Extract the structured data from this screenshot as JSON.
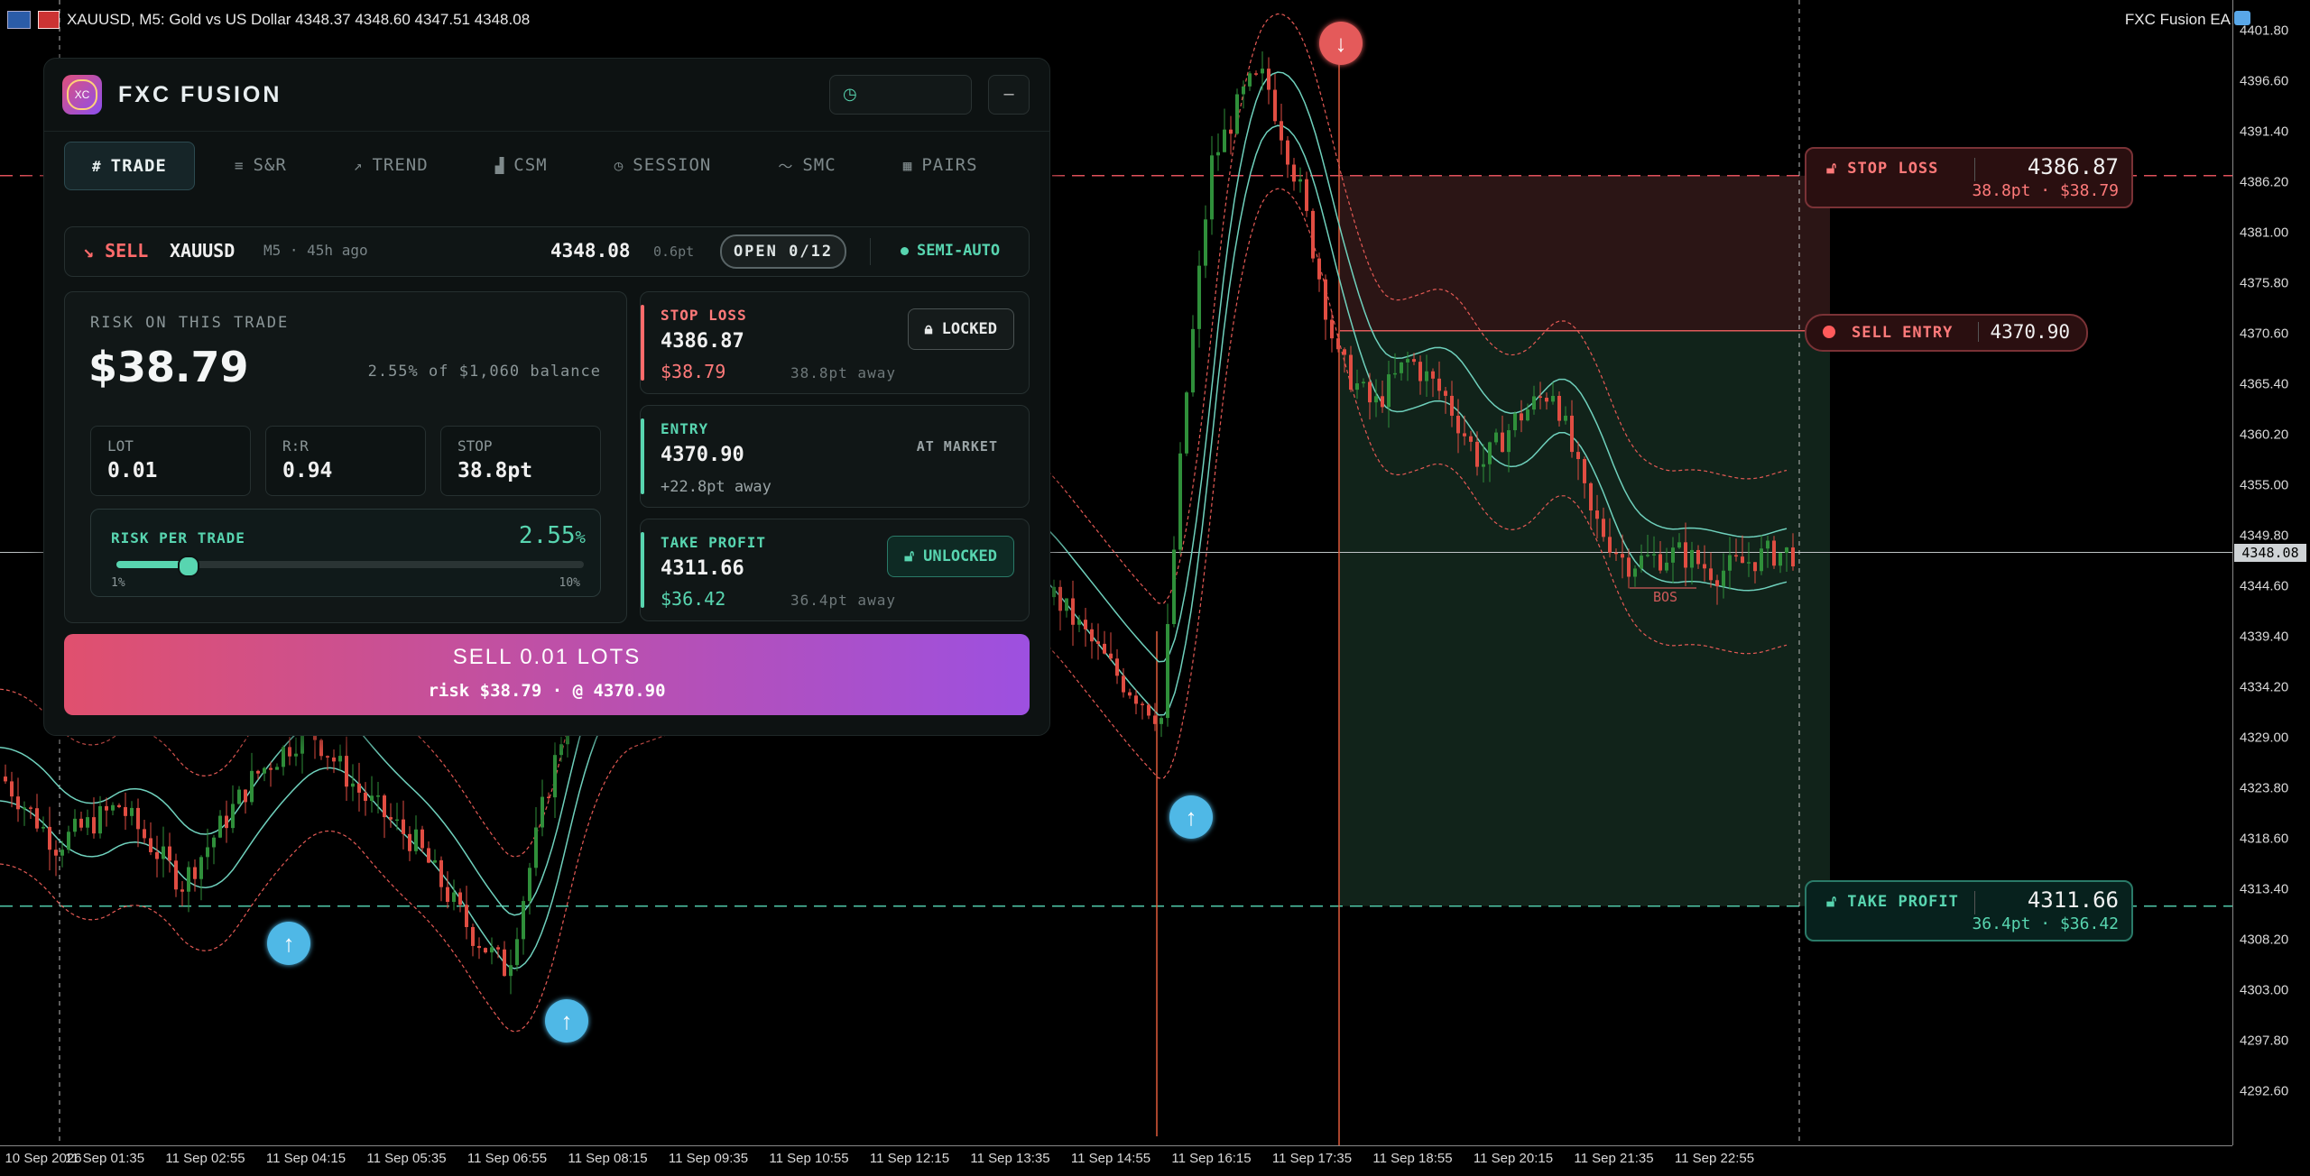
{
  "chart_header": {
    "title": "XAUUSD, M5:  Gold vs US Dollar   4348.37 4348.60 4347.51 4348.08",
    "ea_name": "FXC Fusion EA"
  },
  "colors": {
    "bull": "#2f8f3a",
    "bear": "#e04d42",
    "sl": "#ff6b6b",
    "tp": "#58d5b0",
    "band_inner": "#6fd1bd",
    "band_outer": "#e55a55"
  },
  "y_axis": {
    "ticks": [
      "4401.80",
      "4396.60",
      "4391.40",
      "4386.20",
      "4381.00",
      "4375.80",
      "4370.60",
      "4365.40",
      "4360.20",
      "4355.00",
      "4349.80",
      "4344.60",
      "4339.40",
      "4334.20",
      "4329.00",
      "4323.80",
      "4318.60",
      "4313.40",
      "4308.20",
      "4303.00",
      "4297.80",
      "4292.60"
    ],
    "current_price": "4348.08"
  },
  "x_axis": {
    "ticks": [
      "10 Sep 2026",
      "11 Sep 01:35",
      "11 Sep 02:55",
      "11 Sep 04:15",
      "11 Sep 05:35",
      "11 Sep 06:55",
      "11 Sep 08:15",
      "11 Sep 09:35",
      "11 Sep 10:55",
      "11 Sep 12:15",
      "11 Sep 13:35",
      "11 Sep 14:55",
      "11 Sep 16:15",
      "11 Sep 17:35",
      "11 Sep 18:55",
      "11 Sep 20:15",
      "11 Sep 21:35",
      "11 Sep 22:55"
    ]
  },
  "chart_data": {
    "type": "candlestick",
    "ylim": [
      4288.0,
      4404.0
    ],
    "levels": {
      "stop_loss": 4386.87,
      "entry": 4370.9,
      "take_profit": 4311.66,
      "current": 4348.08
    },
    "segments": [
      {
        "x": 0,
        "p": 4325
      },
      {
        "x": 60,
        "p": 4318
      },
      {
        "x": 130,
        "p": 4322
      },
      {
        "x": 200,
        "p": 4314
      },
      {
        "x": 280,
        "p": 4325
      },
      {
        "x": 340,
        "p": 4330
      },
      {
        "x": 400,
        "p": 4323
      },
      {
        "x": 460,
        "p": 4318
      },
      {
        "x": 520,
        "p": 4309
      },
      {
        "x": 560,
        "p": 4305
      },
      {
        "x": 600,
        "p": 4322
      },
      {
        "x": 640,
        "p": 4336
      },
      {
        "x": 700,
        "p": 4338
      },
      {
        "x": 760,
        "p": 4340
      },
      {
        "x": 820,
        "p": 4345
      },
      {
        "x": 880,
        "p": 4350
      },
      {
        "x": 940,
        "p": 4348
      },
      {
        "x": 1000,
        "p": 4351
      },
      {
        "x": 1060,
        "p": 4352
      },
      {
        "x": 1120,
        "p": 4349
      },
      {
        "x": 1180,
        "p": 4342
      },
      {
        "x": 1240,
        "p": 4335
      },
      {
        "x": 1285,
        "p": 4331
      },
      {
        "x": 1310,
        "p": 4362
      },
      {
        "x": 1340,
        "p": 4388
      },
      {
        "x": 1380,
        "p": 4396
      },
      {
        "x": 1400,
        "p": 4397
      },
      {
        "x": 1440,
        "p": 4385
      },
      {
        "x": 1480,
        "p": 4368
      },
      {
        "x": 1520,
        "p": 4363
      },
      {
        "x": 1560,
        "p": 4368
      },
      {
        "x": 1600,
        "p": 4364
      },
      {
        "x": 1640,
        "p": 4357
      },
      {
        "x": 1680,
        "p": 4362
      },
      {
        "x": 1720,
        "p": 4365
      },
      {
        "x": 1760,
        "p": 4352
      },
      {
        "x": 1800,
        "p": 4347
      },
      {
        "x": 1860,
        "p": 4348
      },
      {
        "x": 1900,
        "p": 4346
      },
      {
        "x": 1960,
        "p": 4348
      },
      {
        "x": 1985,
        "p": 4348
      }
    ],
    "signals": [
      {
        "type": "buy",
        "time_index": 4,
        "price": 4306.6
      },
      {
        "type": "buy",
        "time_index": 5,
        "price": 4301.9
      },
      {
        "type": "buy",
        "time_index": 11,
        "price": 4325.2
      },
      {
        "type": "sell",
        "time_index": 12,
        "price": 4400.9
      }
    ],
    "annotations": [
      "BOS"
    ]
  },
  "chart_tags": {
    "stop_loss": {
      "label": "STOP LOSS",
      "price": "4386.87",
      "sub": "38.8pt · $38.79"
    },
    "sell_entry": {
      "label": "SELL ENTRY",
      "price": "4370.90"
    },
    "take_profit": {
      "label": "TAKE PROFIT",
      "price": "4311.66",
      "sub": "36.4pt · $36.42"
    },
    "bos": "BOS"
  },
  "panel": {
    "brand": "FXC FUSION",
    "logo_text": "XC",
    "minimize": "–",
    "tabs": [
      {
        "icon": "#",
        "label": "TRADE"
      },
      {
        "icon": "≡",
        "label": "S&R"
      },
      {
        "icon": "↗",
        "label": "TREND"
      },
      {
        "icon": "▟",
        "label": "CSM"
      },
      {
        "icon": "◷",
        "label": "SESSION"
      },
      {
        "icon": "〜",
        "label": "SMC"
      },
      {
        "icon": "▦",
        "label": "PAIRS"
      }
    ],
    "trade_bar": {
      "side": "↘ SELL",
      "symbol": "XAUUSD",
      "meta": "M5 · 45h ago",
      "price": "4348.08",
      "spread": "0.6pt",
      "open": "OPEN 0/12",
      "mode": "SEMI-AUTO"
    },
    "risk": {
      "label": "RISK ON THIS TRADE",
      "amount": "$38.79",
      "pct_of_balance": "2.55% of $1,060 balance",
      "lot_label": "LOT",
      "lot": "0.01",
      "rr_label": "R:R",
      "rr": "0.94",
      "stop_label": "STOP",
      "stop": "38.8pt",
      "per_trade_label": "RISK PER TRADE",
      "per_trade_value": "2.55",
      "per_trade_unit": "%",
      "slider_fraction": 0.155,
      "min": "1%",
      "max": "10%"
    },
    "stop_loss": {
      "label": "STOP LOSS",
      "price": "4386.87",
      "money": "$38.79",
      "distance": "38.8pt away",
      "state": "LOCKED"
    },
    "entry": {
      "label": "ENTRY",
      "price": "4370.90",
      "distance": "+22.8pt away",
      "mode": "AT MARKET"
    },
    "take_profit": {
      "label": "TAKE PROFIT",
      "price": "4311.66",
      "money": "$36.42",
      "distance": "36.4pt away",
      "state": "UNLOCKED"
    },
    "sell_button": {
      "title": "SELL 0.01 LOTS",
      "sub": "risk $38.79 · @ 4370.90"
    }
  }
}
